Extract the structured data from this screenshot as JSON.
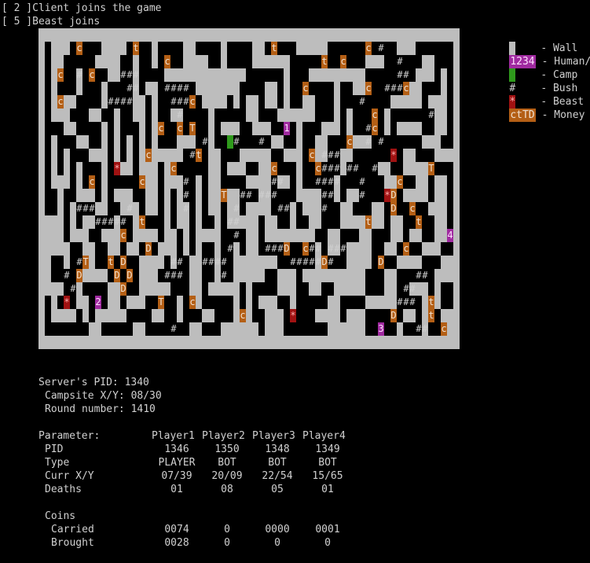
{
  "log": [
    "[ 2 ]Client joins the game",
    "[ 5 ]Beast joins"
  ],
  "legend": [
    {
      "key": "wall",
      "symbol": " ",
      "label": "- Wall"
    },
    {
      "key": "human",
      "symbol": "1234",
      "label": "- Human/CPU"
    },
    {
      "key": "camp",
      "symbol": " ",
      "label": "- Camp"
    },
    {
      "key": "bush",
      "symbol": "#",
      "label": "- Bush"
    },
    {
      "key": "beast",
      "symbol": "*",
      "label": "- Beast"
    },
    {
      "key": "money",
      "symbol": "ctTD",
      "label": "- Money"
    }
  ],
  "colors": {
    "wall": "#bdbdbd",
    "coin": "#b45f15",
    "beast": "#a01212",
    "player": "#a02aa0",
    "camp": "#2f9a1c",
    "bg": "#000000"
  },
  "server": {
    "pid_line": "Server's PID: 1340",
    "campsite_line": "Campsite X/Y: 08/30",
    "round_line": "Round number: 1410"
  },
  "table": {
    "header": "Parameter:",
    "players": [
      "Player1",
      "Player2",
      "Player3",
      "Player4"
    ],
    "rows": [
      {
        "label": "PID",
        "values": [
          "1346",
          "1350",
          "1348",
          "1349"
        ]
      },
      {
        "label": "Type",
        "values": [
          "PLAYER",
          "BOT",
          "BOT",
          "BOT"
        ]
      },
      {
        "label": "Curr X/Y",
        "values": [
          "07/39",
          "20/09",
          "22/54",
          "15/65"
        ]
      },
      {
        "label": "Deaths",
        "values": [
          "01",
          "08",
          "05",
          "01"
        ]
      }
    ],
    "coins_header": "Coins",
    "coins": [
      {
        "label": "Carried",
        "values": [
          "0074",
          "0",
          "0000",
          "0001"
        ]
      },
      {
        "label": "Brought",
        "values": [
          "0028",
          "0",
          "0",
          "0"
        ]
      }
    ]
  },
  "map": {
    "cols": 67,
    "rows": 24,
    "items": [
      {
        "t": "coin",
        "c": "c",
        "r": 1,
        "x": 6
      },
      {
        "t": "coin",
        "c": "t",
        "r": 1,
        "x": 15
      },
      {
        "t": "coin",
        "c": "t",
        "r": 1,
        "x": 37
      },
      {
        "t": "coin",
        "c": "c",
        "r": 1,
        "x": 52
      },
      {
        "t": "bush",
        "c": "#",
        "r": 1,
        "x": 54
      },
      {
        "t": "coin",
        "c": "c",
        "r": 2,
        "x": 20
      },
      {
        "t": "coin",
        "c": "t",
        "r": 2,
        "x": 45
      },
      {
        "t": "coin",
        "c": "c",
        "r": 2,
        "x": 48
      },
      {
        "t": "bush",
        "c": "#",
        "r": 2,
        "x": 57
      },
      {
        "t": "coin",
        "c": "c",
        "r": 3,
        "x": 3
      },
      {
        "t": "bush",
        "c": "#",
        "r": 3,
        "x": 6
      },
      {
        "t": "coin",
        "c": "c",
        "r": 3,
        "x": 8
      },
      {
        "t": "bush",
        "c": "###",
        "r": 3,
        "x": 13
      },
      {
        "t": "bush",
        "c": "##",
        "r": 3,
        "x": 57
      },
      {
        "t": "bush",
        "c": "##",
        "r": 4,
        "x": 14
      },
      {
        "t": "bush",
        "c": "####",
        "r": 4,
        "x": 20
      },
      {
        "t": "coin",
        "c": "c",
        "r": 4,
        "x": 42
      },
      {
        "t": "coin",
        "c": "c",
        "r": 4,
        "x": 52
      },
      {
        "t": "bush",
        "c": "###",
        "r": 4,
        "x": 55
      },
      {
        "t": "coin",
        "c": "c",
        "r": 4,
        "x": 58
      },
      {
        "t": "coin",
        "c": "c",
        "r": 5,
        "x": 3
      },
      {
        "t": "bush",
        "c": "####",
        "r": 5,
        "x": 11
      },
      {
        "t": "bush",
        "c": "###",
        "r": 5,
        "x": 21
      },
      {
        "t": "coin",
        "c": "c",
        "r": 5,
        "x": 24
      },
      {
        "t": "bush",
        "c": "#",
        "r": 5,
        "x": 51
      },
      {
        "t": "bush",
        "c": "#",
        "r": 6,
        "x": 22
      },
      {
        "t": "coin",
        "c": "c",
        "r": 6,
        "x": 53
      },
      {
        "t": "bush",
        "c": "#",
        "r": 6,
        "x": 62
      },
      {
        "t": "coin",
        "c": "c",
        "r": 7,
        "x": 19
      },
      {
        "t": "coin",
        "c": "c",
        "r": 7,
        "x": 22
      },
      {
        "t": "coin",
        "c": "T",
        "r": 7,
        "x": 24
      },
      {
        "t": "player",
        "c": "1",
        "r": 7,
        "x": 39
      },
      {
        "t": "bush",
        "c": "#",
        "r": 7,
        "x": 52
      },
      {
        "t": "coin",
        "c": "c",
        "r": 7,
        "x": 53
      },
      {
        "t": "bush",
        "c": "#",
        "r": 8,
        "x": 26
      },
      {
        "t": "camp",
        "c": " ",
        "r": 8,
        "x": 30
      },
      {
        "t": "bush",
        "c": "#",
        "r": 8,
        "x": 31
      },
      {
        "t": "bush",
        "c": "#",
        "r": 8,
        "x": 35
      },
      {
        "t": "coin",
        "c": "c",
        "r": 8,
        "x": 49
      },
      {
        "t": "bush",
        "c": "#",
        "r": 8,
        "x": 52
      },
      {
        "t": "bush",
        "c": "#",
        "r": 8,
        "x": 54
      },
      {
        "t": "coin",
        "c": "c",
        "r": 9,
        "x": 17
      },
      {
        "t": "bush",
        "c": "#",
        "r": 9,
        "x": 24
      },
      {
        "t": "coin",
        "c": "t",
        "r": 9,
        "x": 25
      },
      {
        "t": "coin",
        "c": "c",
        "r": 9,
        "x": 43
      },
      {
        "t": "bush",
        "c": "###",
        "r": 9,
        "x": 45
      },
      {
        "t": "beast",
        "c": "*",
        "r": 9,
        "x": 56
      },
      {
        "t": "beast",
        "c": "*",
        "r": 10,
        "x": 12
      },
      {
        "t": "coin",
        "c": "c",
        "r": 10,
        "x": 21
      },
      {
        "t": "coin",
        "c": "c",
        "r": 10,
        "x": 37
      },
      {
        "t": "coin",
        "c": "c",
        "r": 10,
        "x": 44
      },
      {
        "t": "bush",
        "c": "###",
        "r": 10,
        "x": 45
      },
      {
        "t": "bush",
        "c": "##",
        "r": 10,
        "x": 49
      },
      {
        "t": "bush",
        "c": "#",
        "r": 10,
        "x": 53
      },
      {
        "t": "coin",
        "c": "T",
        "r": 10,
        "x": 62
      },
      {
        "t": "coin",
        "c": "c",
        "r": 11,
        "x": 8
      },
      {
        "t": "coin",
        "c": "c",
        "r": 11,
        "x": 16
      },
      {
        "t": "bush",
        "c": "#",
        "r": 11,
        "x": 23
      },
      {
        "t": "bush",
        "c": "##",
        "r": 11,
        "x": 37
      },
      {
        "t": "bush",
        "c": "####",
        "r": 11,
        "x": 44
      },
      {
        "t": "bush",
        "c": "#",
        "r": 11,
        "x": 51
      },
      {
        "t": "coin",
        "c": "c",
        "r": 11,
        "x": 57
      },
      {
        "t": "bush",
        "c": "#",
        "r": 12,
        "x": 23
      },
      {
        "t": "coin",
        "c": "T",
        "r": 12,
        "x": 29
      },
      {
        "t": "bush",
        "c": "##",
        "r": 12,
        "x": 32
      },
      {
        "t": "bush",
        "c": "###",
        "r": 12,
        "x": 35
      },
      {
        "t": "bush",
        "c": "##",
        "r": 12,
        "x": 45
      },
      {
        "t": "bush",
        "c": "#",
        "r": 12,
        "x": 51
      },
      {
        "t": "beast",
        "c": "*",
        "r": 12,
        "x": 55
      },
      {
        "t": "coin",
        "c": "D",
        "r": 12,
        "x": 56
      },
      {
        "t": "bush",
        "c": "###",
        "r": 13,
        "x": 6
      },
      {
        "t": "bush",
        "c": "#",
        "r": 13,
        "x": 14
      },
      {
        "t": "bush",
        "c": "#",
        "r": 13,
        "x": 23
      },
      {
        "t": "bush",
        "c": "#",
        "r": 13,
        "x": 31
      },
      {
        "t": "bush",
        "c": "##",
        "r": 13,
        "x": 38
      },
      {
        "t": "bush",
        "c": "#",
        "r": 13,
        "x": 45
      },
      {
        "t": "coin",
        "c": "D",
        "r": 13,
        "x": 56
      },
      {
        "t": "coin",
        "c": "c",
        "r": 13,
        "x": 59
      },
      {
        "t": "bush",
        "c": "#####",
        "r": 14,
        "x": 9
      },
      {
        "t": "coin",
        "c": "t",
        "r": 14,
        "x": 16
      },
      {
        "t": "bush",
        "c": "##",
        "r": 14,
        "x": 30
      },
      {
        "t": "coin",
        "c": "t",
        "r": 14,
        "x": 52
      },
      {
        "t": "coin",
        "c": "t",
        "r": 14,
        "x": 60
      },
      {
        "t": "coin",
        "c": "c",
        "r": 15,
        "x": 13
      },
      {
        "t": "bush",
        "c": "#",
        "r": 15,
        "x": 31
      },
      {
        "t": "player",
        "c": "4",
        "r": 15,
        "x": 65
      },
      {
        "t": "coin",
        "c": "D",
        "r": 16,
        "x": 17
      },
      {
        "t": "bush",
        "c": "#",
        "r": 16,
        "x": 30
      },
      {
        "t": "bush",
        "c": "###",
        "r": 16,
        "x": 36
      },
      {
        "t": "coin",
        "c": "D",
        "r": 16,
        "x": 39
      },
      {
        "t": "coin",
        "c": "c",
        "r": 16,
        "x": 42
      },
      {
        "t": "bush",
        "c": "##",
        "r": 16,
        "x": 43
      },
      {
        "t": "bush",
        "c": "###",
        "r": 16,
        "x": 46
      },
      {
        "t": "coin",
        "c": "c",
        "r": 16,
        "x": 58
      },
      {
        "t": "bush",
        "c": "#",
        "r": 17,
        "x": 6
      },
      {
        "t": "coin",
        "c": "T",
        "r": 17,
        "x": 7
      },
      {
        "t": "coin",
        "c": "t",
        "r": 17,
        "x": 11
      },
      {
        "t": "coin",
        "c": "D",
        "r": 17,
        "x": 13
      },
      {
        "t": "bush",
        "c": "##",
        "r": 17,
        "x": 21
      },
      {
        "t": "bush",
        "c": "####",
        "r": 17,
        "x": 26
      },
      {
        "t": "bush",
        "c": "#####",
        "r": 17,
        "x": 40
      },
      {
        "t": "coin",
        "c": "D",
        "r": 17,
        "x": 45
      },
      {
        "t": "bush",
        "c": "#",
        "r": 17,
        "x": 46
      },
      {
        "t": "coin",
        "c": "D",
        "r": 17,
        "x": 54
      },
      {
        "t": "bush",
        "c": "#",
        "r": 18,
        "x": 4
      },
      {
        "t": "coin",
        "c": "D",
        "r": 18,
        "x": 6
      },
      {
        "t": "coin",
        "c": "D",
        "r": 18,
        "x": 12
      },
      {
        "t": "coin",
        "c": "D",
        "r": 18,
        "x": 14
      },
      {
        "t": "bush",
        "c": "###",
        "r": 18,
        "x": 20
      },
      {
        "t": "bush",
        "c": "#",
        "r": 18,
        "x": 29
      },
      {
        "t": "bush",
        "c": "##",
        "r": 18,
        "x": 60
      },
      {
        "t": "bush",
        "c": "#",
        "r": 19,
        "x": 5
      },
      {
        "t": "coin",
        "c": "D",
        "r": 19,
        "x": 13
      },
      {
        "t": "bush",
        "c": "##",
        "r": 19,
        "x": 58
      },
      {
        "t": "beast",
        "c": "*",
        "r": 20,
        "x": 4
      },
      {
        "t": "player",
        "c": "2",
        "r": 20,
        "x": 9
      },
      {
        "t": "coin",
        "c": "T",
        "r": 20,
        "x": 19
      },
      {
        "t": "coin",
        "c": "c",
        "r": 20,
        "x": 24
      },
      {
        "t": "bush",
        "c": "###",
        "r": 20,
        "x": 57
      },
      {
        "t": "coin",
        "c": "t",
        "r": 20,
        "x": 62
      },
      {
        "t": "coin",
        "c": "c",
        "r": 21,
        "x": 32
      },
      {
        "t": "beast",
        "c": "*",
        "r": 21,
        "x": 40
      },
      {
        "t": "coin",
        "c": "D",
        "r": 21,
        "x": 56
      },
      {
        "t": "coin",
        "c": "t",
        "r": 21,
        "x": 62
      },
      {
        "t": "bush",
        "c": "#",
        "r": 22,
        "x": 21
      },
      {
        "t": "player",
        "c": "3",
        "r": 22,
        "x": 54
      },
      {
        "t": "bush",
        "c": "##",
        "r": 22,
        "x": 60
      },
      {
        "t": "coin",
        "c": "c",
        "r": 22,
        "x": 64
      }
    ]
  }
}
